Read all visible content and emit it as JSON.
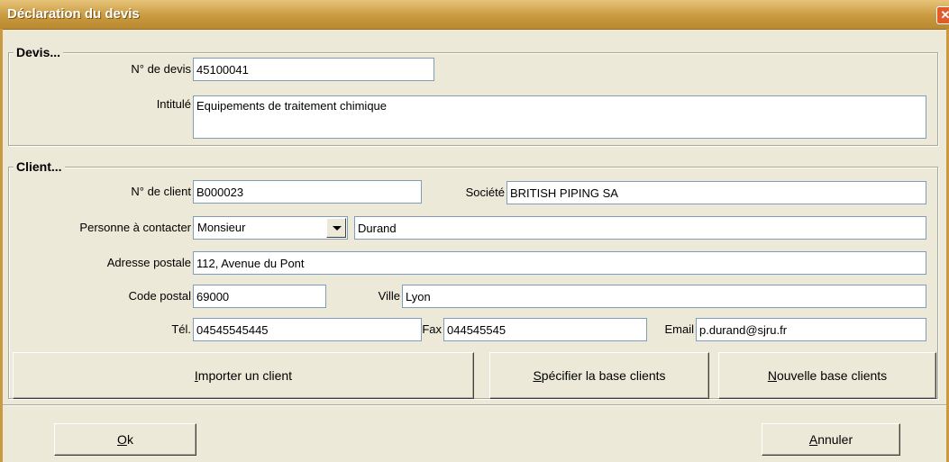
{
  "window": {
    "title": "Déclaration du devis",
    "close_glyph": "✕"
  },
  "devis": {
    "legend": "Devis...",
    "numero_label": "N° de devis",
    "numero_value": "45100041",
    "intitule_label": "Intitulé",
    "intitule_value": "Equipements de traitement chimique"
  },
  "client": {
    "legend": "Client...",
    "numero_label": "N° de client",
    "numero_value": "B000023",
    "societe_label": "Société",
    "societe_value": "BRITISH PIPING SA",
    "contact_label": "Personne à contacter",
    "civilite_value": "Monsieur",
    "contact_name_value": "Durand",
    "adresse_label": "Adresse postale",
    "adresse_value": "112, Avenue du Pont",
    "cp_label": "Code postal",
    "cp_value": "69000",
    "ville_label": "Ville",
    "ville_value": "Lyon",
    "tel_label": "Tél.",
    "tel_value": "04545545445",
    "fax_label": "Fax",
    "fax_value": "044545545",
    "email_label": "Email",
    "email_value": "p.durand@sjru.fr"
  },
  "buttons": {
    "importer": {
      "acc": "I",
      "rest": "mporter un client"
    },
    "specifier": {
      "acc": "S",
      "rest": "pécifier la base clients"
    },
    "nouvelle": {
      "acc": "N",
      "rest": "ouvelle base clients"
    },
    "ok": {
      "acc": "O",
      "rest": "k"
    },
    "annuler": {
      "acc": "A",
      "rest": "nnuler"
    }
  }
}
